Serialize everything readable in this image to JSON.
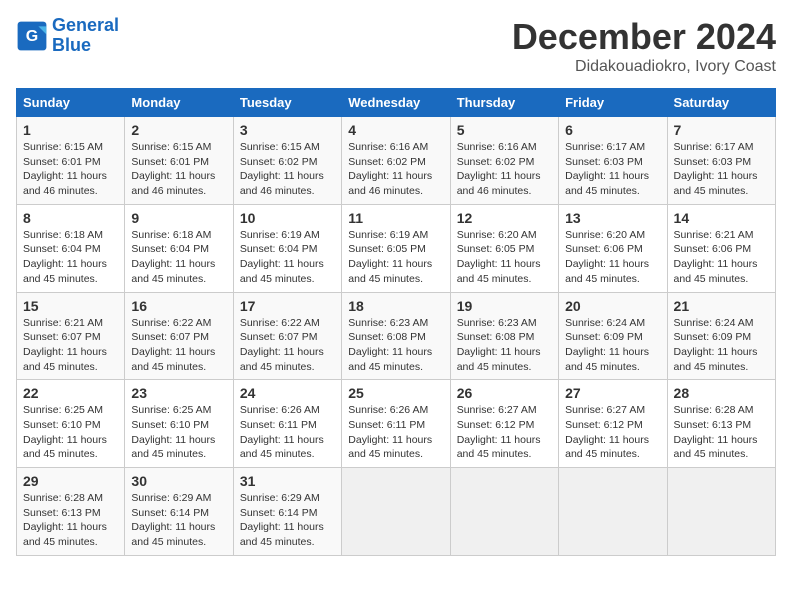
{
  "header": {
    "logo_line1": "General",
    "logo_line2": "Blue",
    "month": "December 2024",
    "location": "Didakouadiokro, Ivory Coast"
  },
  "days_of_week": [
    "Sunday",
    "Monday",
    "Tuesday",
    "Wednesday",
    "Thursday",
    "Friday",
    "Saturday"
  ],
  "weeks": [
    [
      {
        "day": 1,
        "sunrise": "6:15 AM",
        "sunset": "6:01 PM",
        "daylight": "11 hours and 46 minutes."
      },
      {
        "day": 2,
        "sunrise": "6:15 AM",
        "sunset": "6:01 PM",
        "daylight": "11 hours and 46 minutes."
      },
      {
        "day": 3,
        "sunrise": "6:15 AM",
        "sunset": "6:02 PM",
        "daylight": "11 hours and 46 minutes."
      },
      {
        "day": 4,
        "sunrise": "6:16 AM",
        "sunset": "6:02 PM",
        "daylight": "11 hours and 46 minutes."
      },
      {
        "day": 5,
        "sunrise": "6:16 AM",
        "sunset": "6:02 PM",
        "daylight": "11 hours and 46 minutes."
      },
      {
        "day": 6,
        "sunrise": "6:17 AM",
        "sunset": "6:03 PM",
        "daylight": "11 hours and 45 minutes."
      },
      {
        "day": 7,
        "sunrise": "6:17 AM",
        "sunset": "6:03 PM",
        "daylight": "11 hours and 45 minutes."
      }
    ],
    [
      {
        "day": 8,
        "sunrise": "6:18 AM",
        "sunset": "6:04 PM",
        "daylight": "11 hours and 45 minutes."
      },
      {
        "day": 9,
        "sunrise": "6:18 AM",
        "sunset": "6:04 PM",
        "daylight": "11 hours and 45 minutes."
      },
      {
        "day": 10,
        "sunrise": "6:19 AM",
        "sunset": "6:04 PM",
        "daylight": "11 hours and 45 minutes."
      },
      {
        "day": 11,
        "sunrise": "6:19 AM",
        "sunset": "6:05 PM",
        "daylight": "11 hours and 45 minutes."
      },
      {
        "day": 12,
        "sunrise": "6:20 AM",
        "sunset": "6:05 PM",
        "daylight": "11 hours and 45 minutes."
      },
      {
        "day": 13,
        "sunrise": "6:20 AM",
        "sunset": "6:06 PM",
        "daylight": "11 hours and 45 minutes."
      },
      {
        "day": 14,
        "sunrise": "6:21 AM",
        "sunset": "6:06 PM",
        "daylight": "11 hours and 45 minutes."
      }
    ],
    [
      {
        "day": 15,
        "sunrise": "6:21 AM",
        "sunset": "6:07 PM",
        "daylight": "11 hours and 45 minutes."
      },
      {
        "day": 16,
        "sunrise": "6:22 AM",
        "sunset": "6:07 PM",
        "daylight": "11 hours and 45 minutes."
      },
      {
        "day": 17,
        "sunrise": "6:22 AM",
        "sunset": "6:07 PM",
        "daylight": "11 hours and 45 minutes."
      },
      {
        "day": 18,
        "sunrise": "6:23 AM",
        "sunset": "6:08 PM",
        "daylight": "11 hours and 45 minutes."
      },
      {
        "day": 19,
        "sunrise": "6:23 AM",
        "sunset": "6:08 PM",
        "daylight": "11 hours and 45 minutes."
      },
      {
        "day": 20,
        "sunrise": "6:24 AM",
        "sunset": "6:09 PM",
        "daylight": "11 hours and 45 minutes."
      },
      {
        "day": 21,
        "sunrise": "6:24 AM",
        "sunset": "6:09 PM",
        "daylight": "11 hours and 45 minutes."
      }
    ],
    [
      {
        "day": 22,
        "sunrise": "6:25 AM",
        "sunset": "6:10 PM",
        "daylight": "11 hours and 45 minutes."
      },
      {
        "day": 23,
        "sunrise": "6:25 AM",
        "sunset": "6:10 PM",
        "daylight": "11 hours and 45 minutes."
      },
      {
        "day": 24,
        "sunrise": "6:26 AM",
        "sunset": "6:11 PM",
        "daylight": "11 hours and 45 minutes."
      },
      {
        "day": 25,
        "sunrise": "6:26 AM",
        "sunset": "6:11 PM",
        "daylight": "11 hours and 45 minutes."
      },
      {
        "day": 26,
        "sunrise": "6:27 AM",
        "sunset": "6:12 PM",
        "daylight": "11 hours and 45 minutes."
      },
      {
        "day": 27,
        "sunrise": "6:27 AM",
        "sunset": "6:12 PM",
        "daylight": "11 hours and 45 minutes."
      },
      {
        "day": 28,
        "sunrise": "6:28 AM",
        "sunset": "6:13 PM",
        "daylight": "11 hours and 45 minutes."
      }
    ],
    [
      {
        "day": 29,
        "sunrise": "6:28 AM",
        "sunset": "6:13 PM",
        "daylight": "11 hours and 45 minutes."
      },
      {
        "day": 30,
        "sunrise": "6:29 AM",
        "sunset": "6:14 PM",
        "daylight": "11 hours and 45 minutes."
      },
      {
        "day": 31,
        "sunrise": "6:29 AM",
        "sunset": "6:14 PM",
        "daylight": "11 hours and 45 minutes."
      },
      null,
      null,
      null,
      null
    ]
  ]
}
